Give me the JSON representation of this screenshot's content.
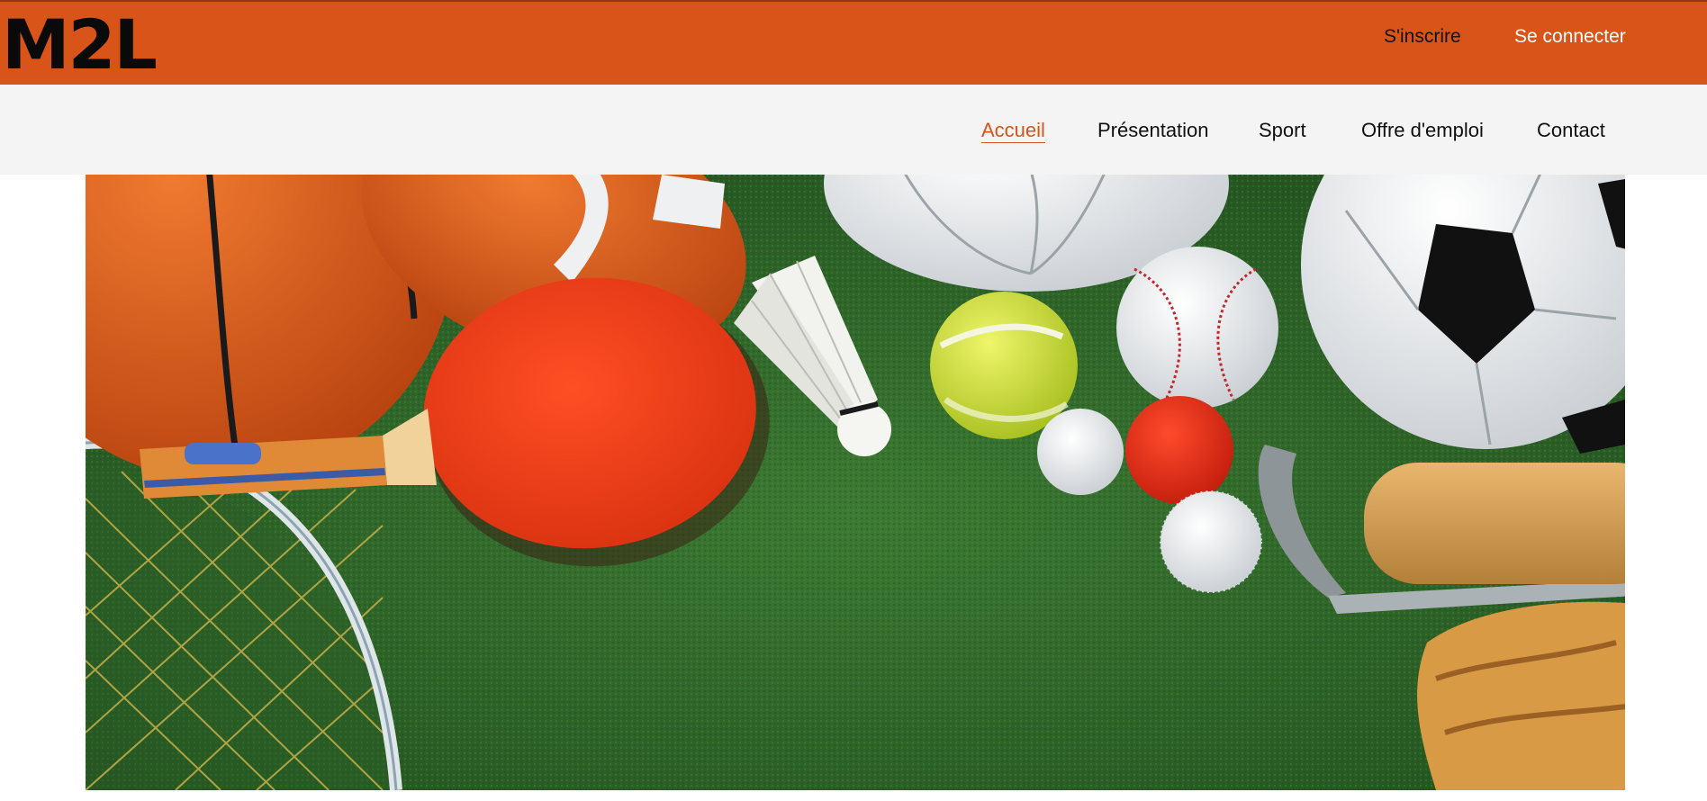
{
  "header": {
    "logo_text": "M2L",
    "signup_label": "S'inscrire",
    "signin_label": "Se connecter",
    "brand_color": "#d85419"
  },
  "nav": {
    "items": [
      {
        "label": "Accueil",
        "active": true
      },
      {
        "label": "Présentation",
        "active": false
      },
      {
        "label": "Sport",
        "active": false
      },
      {
        "label": "Offre d'emploi",
        "active": false
      },
      {
        "label": "Contact",
        "active": false
      }
    ],
    "active_color": "#d85419"
  },
  "hero": {
    "image": "sports-equipment-on-grass"
  }
}
